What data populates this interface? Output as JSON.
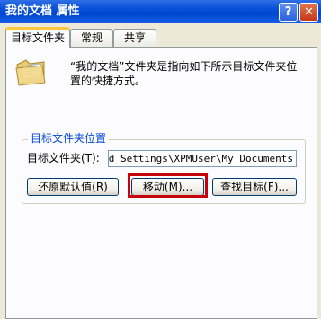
{
  "window": {
    "title": "我的文档 属性",
    "help_label": "?",
    "close_label": "✕"
  },
  "tabs": [
    {
      "label": "目标文件夹",
      "active": true
    },
    {
      "label": "常规",
      "active": false
    },
    {
      "label": "共享",
      "active": false
    }
  ],
  "target_tab": {
    "icon": "folder-icon",
    "description": "“我的文档”文件夹是指向如下所示目标文件夹位置的快捷方式。",
    "group_label": "目标文件夹位置",
    "field_label": "目标文件夹(T):",
    "field_value": "and Settings\\XPMUser\\My Documents",
    "buttons": {
      "restore": "还原默认值(R)",
      "move": "移动(M)...",
      "find": "查找目标(F)..."
    }
  },
  "highlight_color": "#c8000c"
}
